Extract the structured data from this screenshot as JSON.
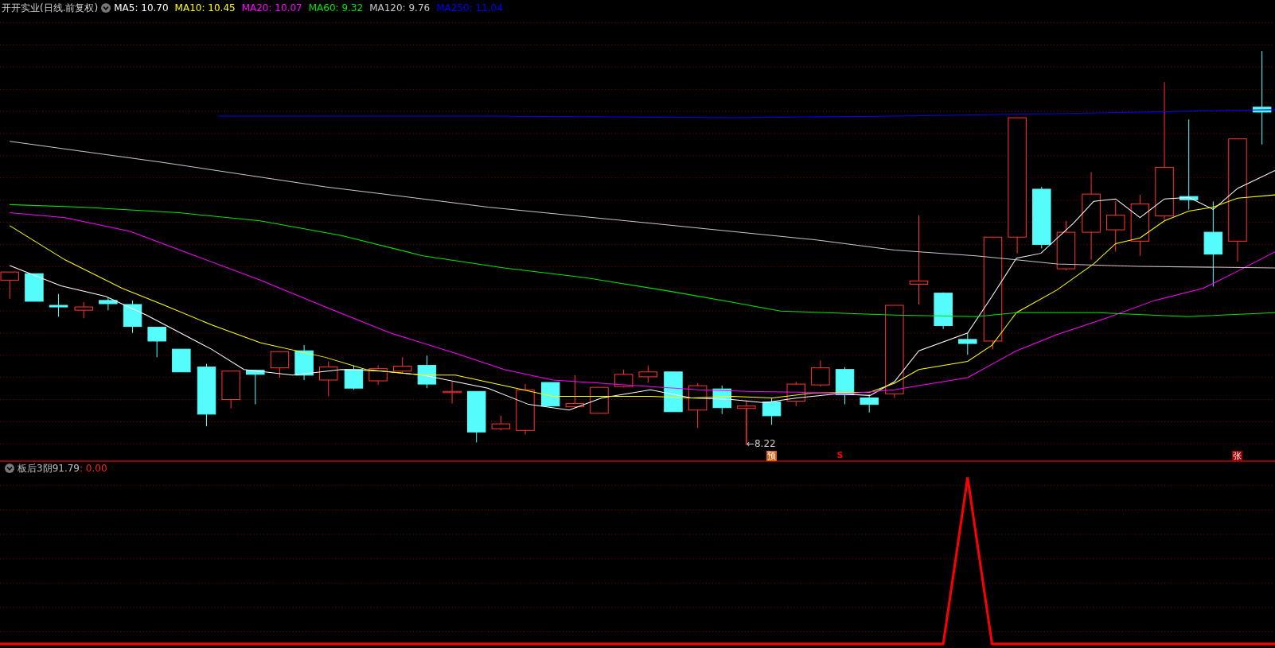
{
  "chart": {
    "title": "开开实业(日线.前复权)",
    "moving_averages": [
      {
        "label": "MA5: 10.70",
        "color": "#ffffff"
      },
      {
        "label": "MA10: 10.45",
        "color": "#ffff00"
      },
      {
        "label": "MA20: 10.07",
        "color": "#ff00ff"
      },
      {
        "label": "MA60: 9.32",
        "color": "#00e600"
      },
      {
        "label": "MA120: 9.76",
        "color": "#c8c8c8"
      },
      {
        "label": "MA250: 11.04",
        "color": "#0000ff"
      }
    ],
    "low_marker": "←8.22",
    "signals": [
      {
        "label": "预",
        "kind": "badge",
        "color": "#d86010"
      },
      {
        "label": "S",
        "kind": "text",
        "color": "#ff0000"
      },
      {
        "label": "张",
        "kind": "badge",
        "color": "#a00000"
      }
    ]
  },
  "indicator": {
    "title": "板后3阴91.79",
    "value": ": 0.00"
  }
}
